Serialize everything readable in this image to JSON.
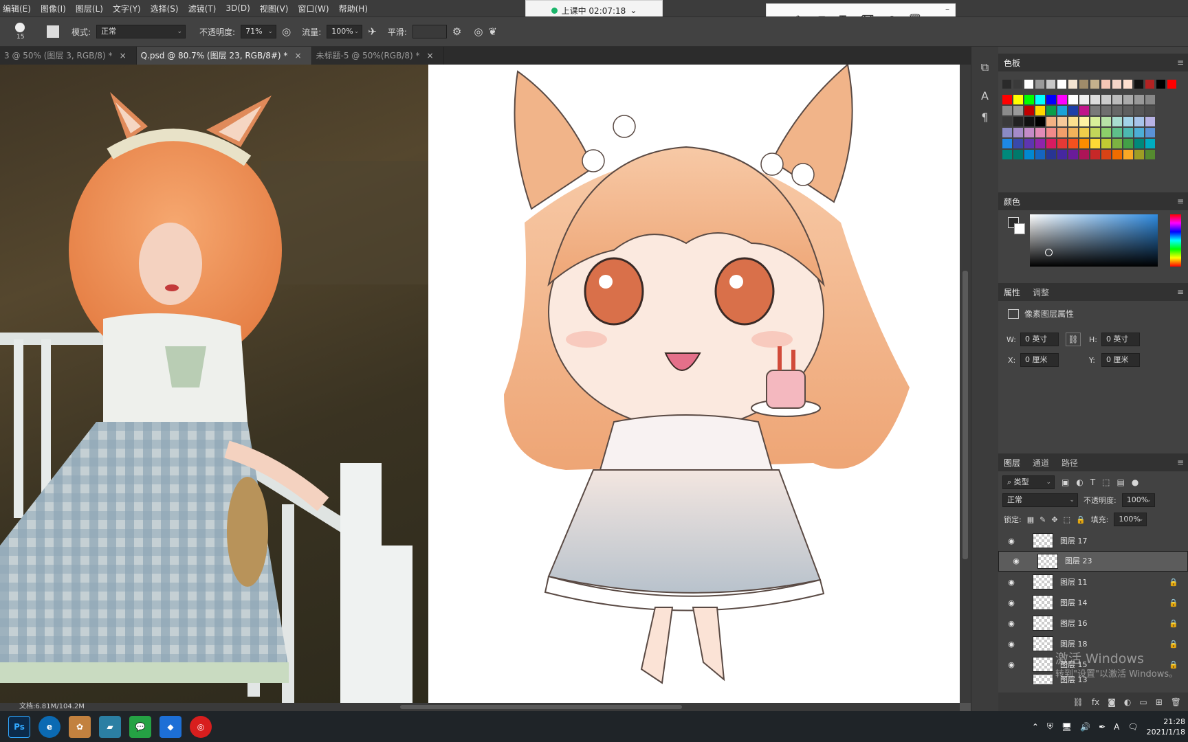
{
  "menu": [
    "编辑(E)",
    "图像(I)",
    "图层(L)",
    "文字(Y)",
    "选择(S)",
    "滤镜(T)",
    "3D(D)",
    "视图(V)",
    "窗口(W)",
    "帮助(H)"
  ],
  "options": {
    "brush_size": "15",
    "mode_label": "模式:",
    "mode_value": "正常",
    "opacity_label": "不透明度:",
    "opacity_value": "71%",
    "flow_label": "流量:",
    "flow_value": "100%",
    "smooth_label": "平滑:"
  },
  "tabs": [
    {
      "label": "3 @ 50% (图层 3, RGB/8) *",
      "active": false
    },
    {
      "label": "Q.psd @ 80.7% (图层 23, RGB/8#) *",
      "active": true
    },
    {
      "label": "未标题-5 @ 50%(RGB/8) *",
      "active": false
    }
  ],
  "status": {
    "doc": "文档:6.81M/104.2M"
  },
  "timer": {
    "text": "上课中 02:07:18"
  },
  "panels": {
    "swatches": {
      "title": "色板"
    },
    "color": {
      "title": "颜色"
    },
    "properties": {
      "tabs": [
        "属性",
        "调整"
      ],
      "subtitle": "像素图层属性",
      "w_label": "W:",
      "w_value": "0 英寸",
      "h_label": "H:",
      "h_value": "0 英寸",
      "x_label": "X:",
      "x_value": "0 厘米",
      "y_label": "Y:",
      "y_value": "0 厘米"
    },
    "layers": {
      "tabs": [
        "图层",
        "通道",
        "路径"
      ],
      "filter": "类型",
      "blend": "正常",
      "opacity_label": "不透明度:",
      "opacity_value": "100%",
      "lock_label": "锁定:",
      "fill_label": "填充:",
      "fill_value": "100%",
      "items": [
        {
          "name": "图层 17",
          "locked": false,
          "selected": false
        },
        {
          "name": "图层 23",
          "locked": false,
          "selected": true
        },
        {
          "name": "图层 11",
          "locked": true,
          "selected": false
        },
        {
          "name": "图层 14",
          "locked": true,
          "selected": false
        },
        {
          "name": "图层 16",
          "locked": true,
          "selected": false
        },
        {
          "name": "图层 18",
          "locked": true,
          "selected": false
        },
        {
          "name": "图层 15",
          "locked": true,
          "selected": false
        },
        {
          "name": "图层 13",
          "locked": false,
          "selected": false
        }
      ]
    }
  },
  "watermark": {
    "line1": "激活 Windows",
    "line2": "转到\"设置\"以激活 Windows。"
  },
  "clock": {
    "time": "21:28",
    "date": "2021/1/18"
  },
  "colors": {
    "swatch_row1": [
      "#2a2a2a",
      "#3a3a3a",
      "#ffffff",
      "#9a9a9a",
      "#c8c8c8",
      "#ffffff",
      "#f3e3d0",
      "#a08c6a",
      "#c4b08c",
      "#f7c6b5",
      "#f5d5c8",
      "#ffe0d0",
      "#111111",
      "#b22222",
      "#000000",
      "#ff0000"
    ]
  }
}
